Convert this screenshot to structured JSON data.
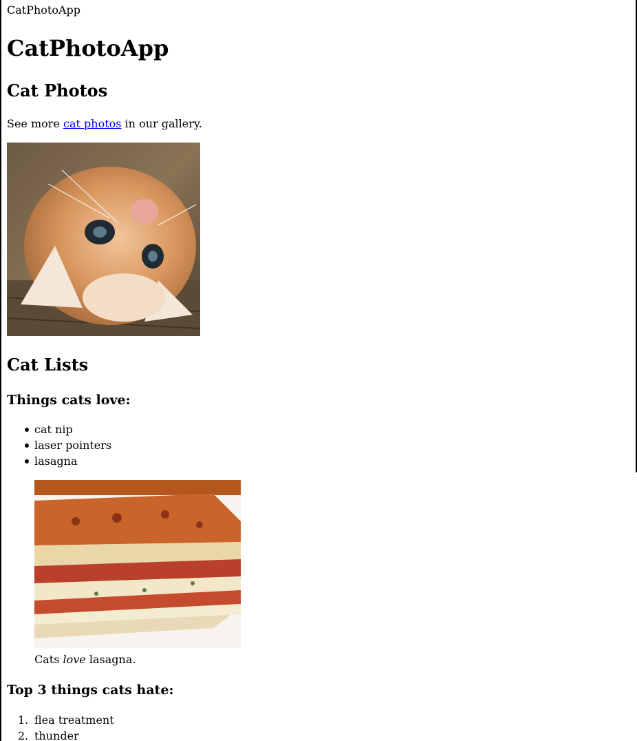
{
  "tab": {
    "title": "CatPhotoApp"
  },
  "header": {
    "title": "CatPhotoApp"
  },
  "photos": {
    "heading": "Cat Photos",
    "text_before": "See more ",
    "link_text": "cat photos",
    "text_after": " in our gallery.",
    "image_icon": "relaxing-cat-photo"
  },
  "lists": {
    "heading": "Cat Lists",
    "love": {
      "heading": "Things cats love:",
      "items": [
        "cat nip",
        "laser pointers",
        "lasagna"
      ]
    },
    "figure": {
      "image_icon": "lasagna-photo",
      "caption_before": "Cats ",
      "caption_em": "love",
      "caption_after": " lasagna."
    },
    "hate": {
      "heading": "Top 3 things cats hate:",
      "numbers": [
        "1.",
        "2."
      ],
      "items": [
        "flea treatment",
        "thunder"
      ]
    }
  }
}
